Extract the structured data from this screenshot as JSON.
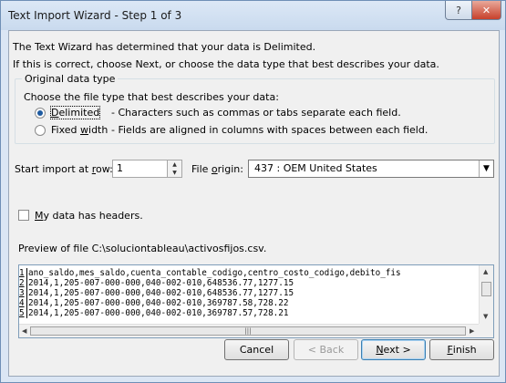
{
  "window": {
    "title": "Text Import Wizard - Step 1 of 3",
    "help_label": "?",
    "close_label": "✕"
  },
  "intro": {
    "line1": "The Text Wizard has determined that your data is Delimited.",
    "line2": "If this is correct, choose Next, or choose the data type that best describes your data."
  },
  "original_data_type": {
    "legend": "Original data type",
    "prompt": "Choose the file type that best describes your data:",
    "options": [
      {
        "label_pre": "",
        "label_key": "D",
        "label_post": "elimited",
        "description": "- Characters such as commas or tabs separate each field.",
        "selected": true
      },
      {
        "label_pre": "Fixed ",
        "label_key": "w",
        "label_post": "idth",
        "description": "- Fields are aligned in columns with spaces between each field.",
        "selected": false
      }
    ]
  },
  "start_import": {
    "label_pre": "Start import at ",
    "label_key": "r",
    "label_post": "ow:",
    "value": "1"
  },
  "file_origin": {
    "label_pre": "File ",
    "label_key": "o",
    "label_post": "rigin:",
    "value": "437 : OEM United States"
  },
  "headers_checkbox": {
    "label_key": "M",
    "label_post": "y data has headers.",
    "checked": false
  },
  "preview": {
    "label": "Preview of file C:\\soluciontableau\\activosfijos.csv.",
    "rows": [
      {
        "num": "1",
        "text": "ano_saldo,mes_saldo,cuenta_contable_codigo,centro_costo_codigo,debito_fis"
      },
      {
        "num": "2",
        "text": "2014,1,205-007-000-000,040-002-010,648536.77,1277.15"
      },
      {
        "num": "3",
        "text": "2014,1,205-007-000-000,040-002-010,648536.77,1277.15"
      },
      {
        "num": "4",
        "text": "2014,1,205-007-000-000,040-002-010,369787.58,728.22"
      },
      {
        "num": "5",
        "text": "2014,1,205-007-000-000,040-002-010,369787.57,728.21"
      }
    ]
  },
  "buttons": {
    "cancel": "Cancel",
    "back": "< Back",
    "next_key": "N",
    "next_post": "ext >",
    "finish_key": "F",
    "finish_post": "inish"
  }
}
